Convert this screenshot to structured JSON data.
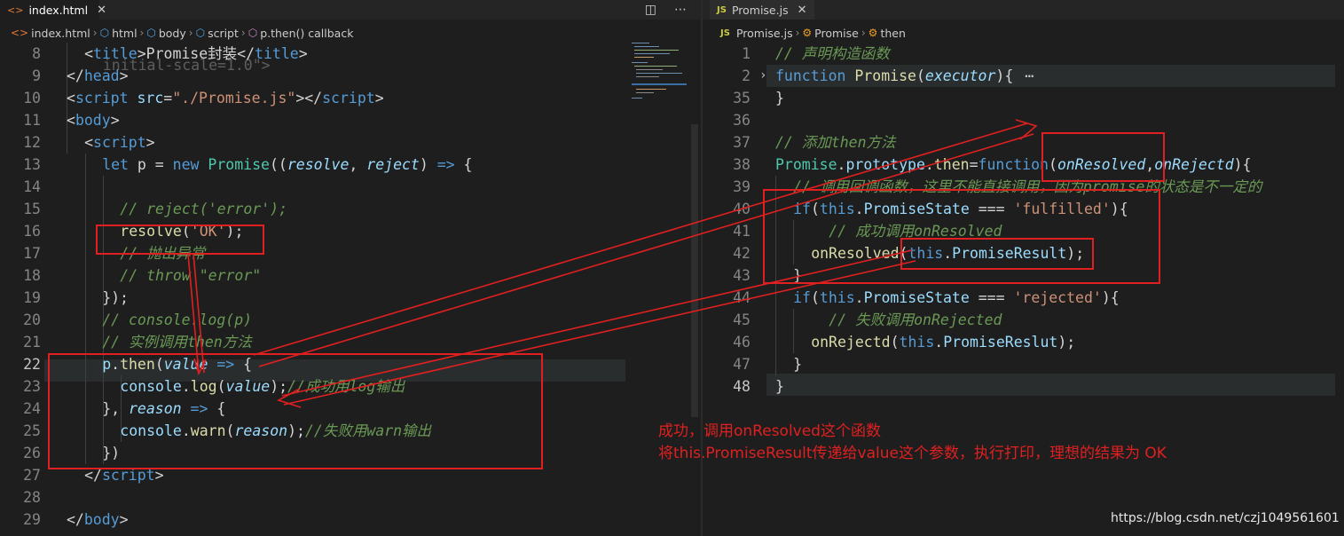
{
  "left_editor": {
    "tab": {
      "icon": "html-file-icon",
      "title": "index.html",
      "close": "✕"
    },
    "actions": [
      "split-editor-icon",
      "more-actions-icon"
    ],
    "breadcrumb": [
      "index.html",
      "html",
      "body",
      "script",
      "p.then() callback"
    ],
    "partial_top_line": "  initial-scale=1.0\">",
    "lines": [
      {
        "n": "8"
      },
      {
        "n": "9"
      },
      {
        "n": "10"
      },
      {
        "n": "11"
      },
      {
        "n": "12"
      },
      {
        "n": "13"
      },
      {
        "n": "14"
      },
      {
        "n": "15"
      },
      {
        "n": "16"
      },
      {
        "n": "17"
      },
      {
        "n": "18"
      },
      {
        "n": "19"
      },
      {
        "n": "20"
      },
      {
        "n": "21"
      },
      {
        "n": "22"
      },
      {
        "n": "23"
      },
      {
        "n": "24"
      },
      {
        "n": "25"
      },
      {
        "n": "26"
      },
      {
        "n": "27"
      },
      {
        "n": "28"
      },
      {
        "n": "29"
      }
    ],
    "current_line": "22"
  },
  "right_editor": {
    "tab": {
      "icon": "js-file-icon",
      "icon_text": "JS",
      "title": "Promise.js",
      "close": "✕"
    },
    "breadcrumb": [
      "Promise.js",
      "Promise",
      "then"
    ],
    "breadcrumb_icon": "JS",
    "fold_marker": "⋯",
    "lines": [
      {
        "n": "1"
      },
      {
        "n": "2"
      },
      {
        "n": "35"
      },
      {
        "n": "36"
      },
      {
        "n": "37"
      },
      {
        "n": "38"
      },
      {
        "n": "39"
      },
      {
        "n": "40"
      },
      {
        "n": "41"
      },
      {
        "n": "42"
      },
      {
        "n": "43"
      },
      {
        "n": "44"
      },
      {
        "n": "45"
      },
      {
        "n": "46"
      },
      {
        "n": "47"
      },
      {
        "n": "48"
      }
    ],
    "current_line": "48"
  },
  "annotation": {
    "line1": "成功，调用onResolved这个函数",
    "line2": "将this.PromiseResult传递给value这个参数，执行打印，理想的结果为 OK",
    "color": "#e02020"
  },
  "watermark": "https://blog.csdn.net/czj1049561601",
  "code_text": {
    "l8": [
      "<",
      "title",
      ">Promise封装</",
      "title",
      ">"
    ],
    "l9": [
      "</",
      "head",
      ">"
    ],
    "l10": [
      "<",
      "script",
      " ",
      "src",
      "=",
      "\"./Promise.js\"",
      "></",
      "script",
      ">"
    ],
    "l11": [
      "<",
      "body",
      ">"
    ],
    "l12": [
      "<",
      "script",
      ">"
    ],
    "l13": [
      "let",
      " p = ",
      "new",
      " ",
      "Promise",
      "((",
      "resolve",
      ", ",
      "reject",
      ") ",
      "=>",
      " {"
    ],
    "l15": "// reject('error');",
    "l16": [
      "resolve",
      "(",
      "'OK'",
      ");"
    ],
    "l17": "// 抛出异常",
    "l18": "// throw \"error\"",
    "l19": "});",
    "l20": "// console.log(p)",
    "l21": "// 实例调用then方法",
    "l22": [
      "p",
      ".",
      "then",
      "(",
      "value",
      " ",
      "=>",
      " {"
    ],
    "l23": [
      "console",
      ".",
      "log",
      "(",
      "value",
      ");",
      "//成功用log输出"
    ],
    "l24": [
      "}, ",
      "reason",
      " ",
      "=>",
      " {"
    ],
    "l25": [
      "console",
      ".",
      "warn",
      "(",
      "reason",
      ");",
      "//失败用warn输出"
    ],
    "l26": "})",
    "l27": [
      "</",
      "script",
      ">"
    ],
    "l29": [
      "</",
      "body",
      ">"
    ],
    "r1": "// 声明构造函数",
    "r2": [
      "function",
      " ",
      "Promise",
      "(",
      "executor",
      "){"
    ],
    "r35": "}",
    "r37": "// 添加then方法",
    "r38": [
      "Promise",
      ".",
      "prototype",
      ".",
      "then",
      "=",
      "function",
      "(",
      "onResolved",
      ",",
      "onRejectd",
      "){"
    ],
    "r39": "// 调用回调函数，这里不能直接调用，因为promise的状态是不一定的",
    "r40": [
      "if",
      "(",
      "this",
      ".",
      "PromiseState",
      " === ",
      "'fulfilled'",
      "){"
    ],
    "r41": "// 成功调用onResolved",
    "r42": [
      "onResolved",
      "(",
      "this",
      ".",
      "PromiseResult",
      ");"
    ],
    "r43": "}",
    "r44": [
      "if",
      "(",
      "this",
      ".",
      "PromiseState",
      " === ",
      "'rejected'",
      "){"
    ],
    "r45": "// 失败调用onRejected",
    "r46": [
      "onRejectd",
      "(",
      "this",
      ".",
      "PromiseReslut",
      ");"
    ],
    "r47": "}",
    "r48": "}"
  }
}
